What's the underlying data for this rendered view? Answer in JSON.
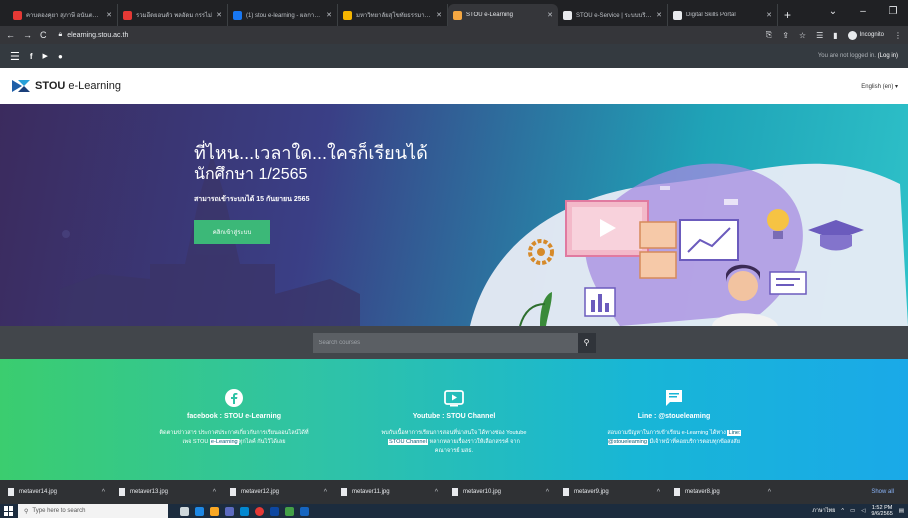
{
  "browser": {
    "tabs": [
      {
        "title": "คาบตองคุยา สุภาษี อนันตมาพาน",
        "color": "#e53935",
        "active": false
      },
      {
        "title": "รวมอีดยอนตัว พลอัดม กรรไม่",
        "color": "#e53935",
        "active": false
      },
      {
        "title": "(1) stou e-learning - ผลการค้นหา",
        "color": "#1877f2",
        "active": false
      },
      {
        "title": "มหาวิทยาลัยสุโขทัยธรรมาธิราช | Sulc",
        "color": "#f4b400",
        "active": false
      },
      {
        "title": "STOU e-Learning",
        "color": "#f4a742",
        "active": true
      },
      {
        "title": "STOU e-Service | ระบบบริการทาง",
        "color": "#e8eaed",
        "active": false
      },
      {
        "title": "Digital Skills Portal",
        "color": "#e8eaed",
        "active": false
      }
    ],
    "url": "elearning.stou.ac.th",
    "incognito_label": "Incognito"
  },
  "sitenav": {
    "login_text": "You are not logged in.",
    "login_link": "(Log in)"
  },
  "header": {
    "logo_bold": "STOU",
    "logo_rest": " e-Learning",
    "language": "English (en)"
  },
  "hero": {
    "title": "ที่ไหน...เวลาใด...ใครก็เรียนได้",
    "subtitle": "นักศึกษา 1/2565",
    "date": "สามารถเข้าระบบได้ 15 กันยายน 2565",
    "button": "คลิกเข้าสู่ระบบ"
  },
  "search": {
    "placeholder": "Search courses"
  },
  "social": [
    {
      "icon": "facebook-icon",
      "heading": "facebook : STOU e-Learning",
      "text_before": "ติดตามข่าวสาร ประกาศประกาศเกี่ยวกับการเรียนออนไลน์ได้ที่เพจ STOU ",
      "highlight": "e-Learning",
      "text_after": "ทุกไลค์ กันไว้ได้เลย"
    },
    {
      "icon": "youtube-icon",
      "heading": "Youtube : STOU Channel",
      "text_before": "พบกับเนื้อหาการเรียนการสอนที่น่าสนใจ ได้ทางช่อง Youtube ",
      "highlight": "STOU Channel",
      "text_after": " หลากหลายเรื่องราวให้เลือกสรรค์ จากคณาจารย์ มสธ."
    },
    {
      "icon": "chat-icon",
      "heading": "Line : @stoueleaming",
      "text_before": "สอบถามปัญหาในการเข้าเรียน e-Learning ได้ทาง ",
      "highlight": "Line: @stoueleaming",
      "text_after": " มีเจ้าหน้าที่คอยบริการตอบทุกข้อสงสัย"
    }
  ],
  "downloads": {
    "files": [
      "metaver14.jpg",
      "metaver13.jpg",
      "metaver12.jpg",
      "metaver11.jpg",
      "metaver10.jpg",
      "metaver9.jpg",
      "metaver8.jpg"
    ],
    "show_all": "Show all"
  },
  "taskbar": {
    "search_placeholder": "Type here to search",
    "time": "1:52 PM",
    "date": "9/6/2565",
    "lang": "ภาษาไทย"
  },
  "colors": {
    "accent_green": "#3cb878",
    "hero_left": "#3b2b5e",
    "hero_right": "#2ec2c9"
  }
}
